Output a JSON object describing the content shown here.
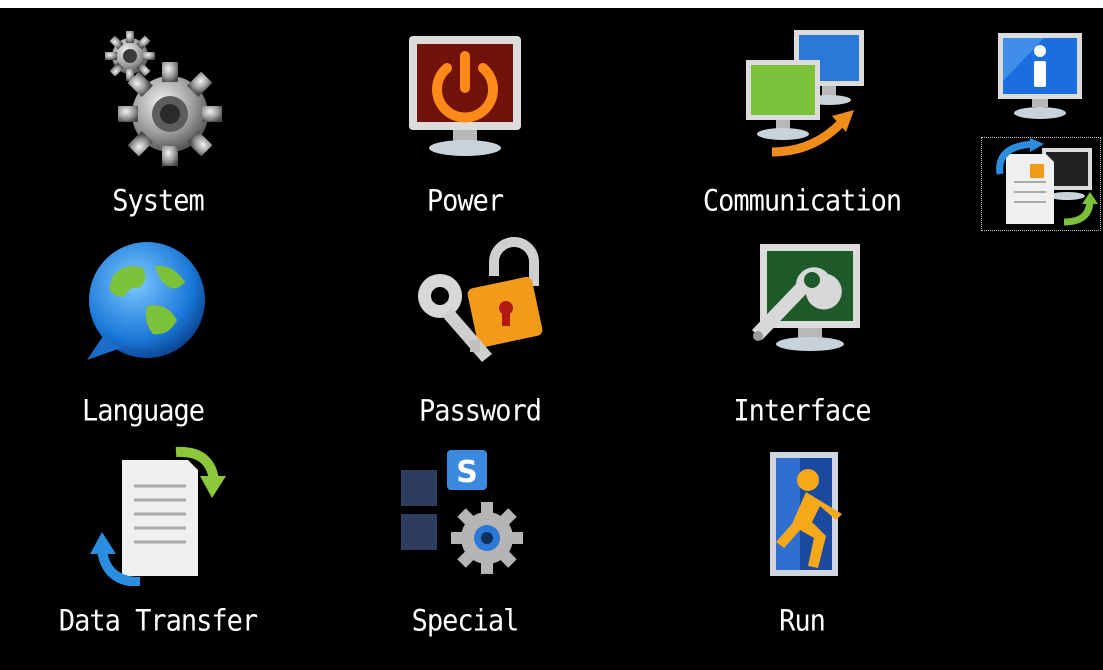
{
  "menu": {
    "items": [
      {
        "id": "system",
        "label": "System",
        "icon": "gears-icon"
      },
      {
        "id": "power",
        "label": "Power",
        "icon": "power-monitor-icon"
      },
      {
        "id": "communication",
        "label": "Communication",
        "icon": "network-monitors-icon"
      },
      {
        "id": "language",
        "label": "Language",
        "icon": "globe-speech-icon"
      },
      {
        "id": "password",
        "label": "Password",
        "icon": "key-lock-icon"
      },
      {
        "id": "interface",
        "label": "Interface",
        "icon": "wrench-monitor-icon"
      },
      {
        "id": "data_transfer",
        "label": "Data Transfer",
        "icon": "document-arrows-icon"
      },
      {
        "id": "special",
        "label": "Special",
        "icon": "special-s-gear-icon"
      },
      {
        "id": "run",
        "label": "Run",
        "icon": "running-man-door-icon"
      }
    ]
  },
  "side": {
    "info_icon": "info-monitor-icon",
    "transfer_icon": "project-transfer-icon"
  },
  "colors": {
    "background": "#000000",
    "label": "#ffffff",
    "accent_orange": "#f08c1a",
    "accent_green": "#7cc13a",
    "accent_blue": "#2a8de0"
  }
}
